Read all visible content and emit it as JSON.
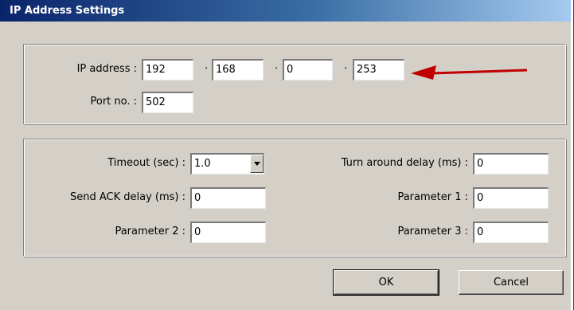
{
  "window": {
    "title": "IP Address Settings"
  },
  "ip": {
    "label": "IP address :",
    "octets": [
      "192",
      "168",
      "0",
      "253"
    ],
    "separator": "·"
  },
  "port": {
    "label": "Port no. :",
    "value": "502"
  },
  "timeout": {
    "label": "Timeout (sec) :",
    "value": "1.0"
  },
  "send_ack": {
    "label": "Send ACK delay (ms) :",
    "value": "0"
  },
  "param2": {
    "label": "Parameter 2 :",
    "value": "0"
  },
  "turn_around": {
    "label": "Turn around delay (ms) :",
    "value": "0"
  },
  "param1": {
    "label": "Parameter 1 :",
    "value": "0"
  },
  "param3": {
    "label": "Parameter 3 :",
    "value": "0"
  },
  "buttons": {
    "ok": "OK",
    "cancel": "Cancel"
  },
  "colors": {
    "face": "#d4d0c8",
    "title_start": "#0a246a",
    "arrow": "#c00000"
  }
}
